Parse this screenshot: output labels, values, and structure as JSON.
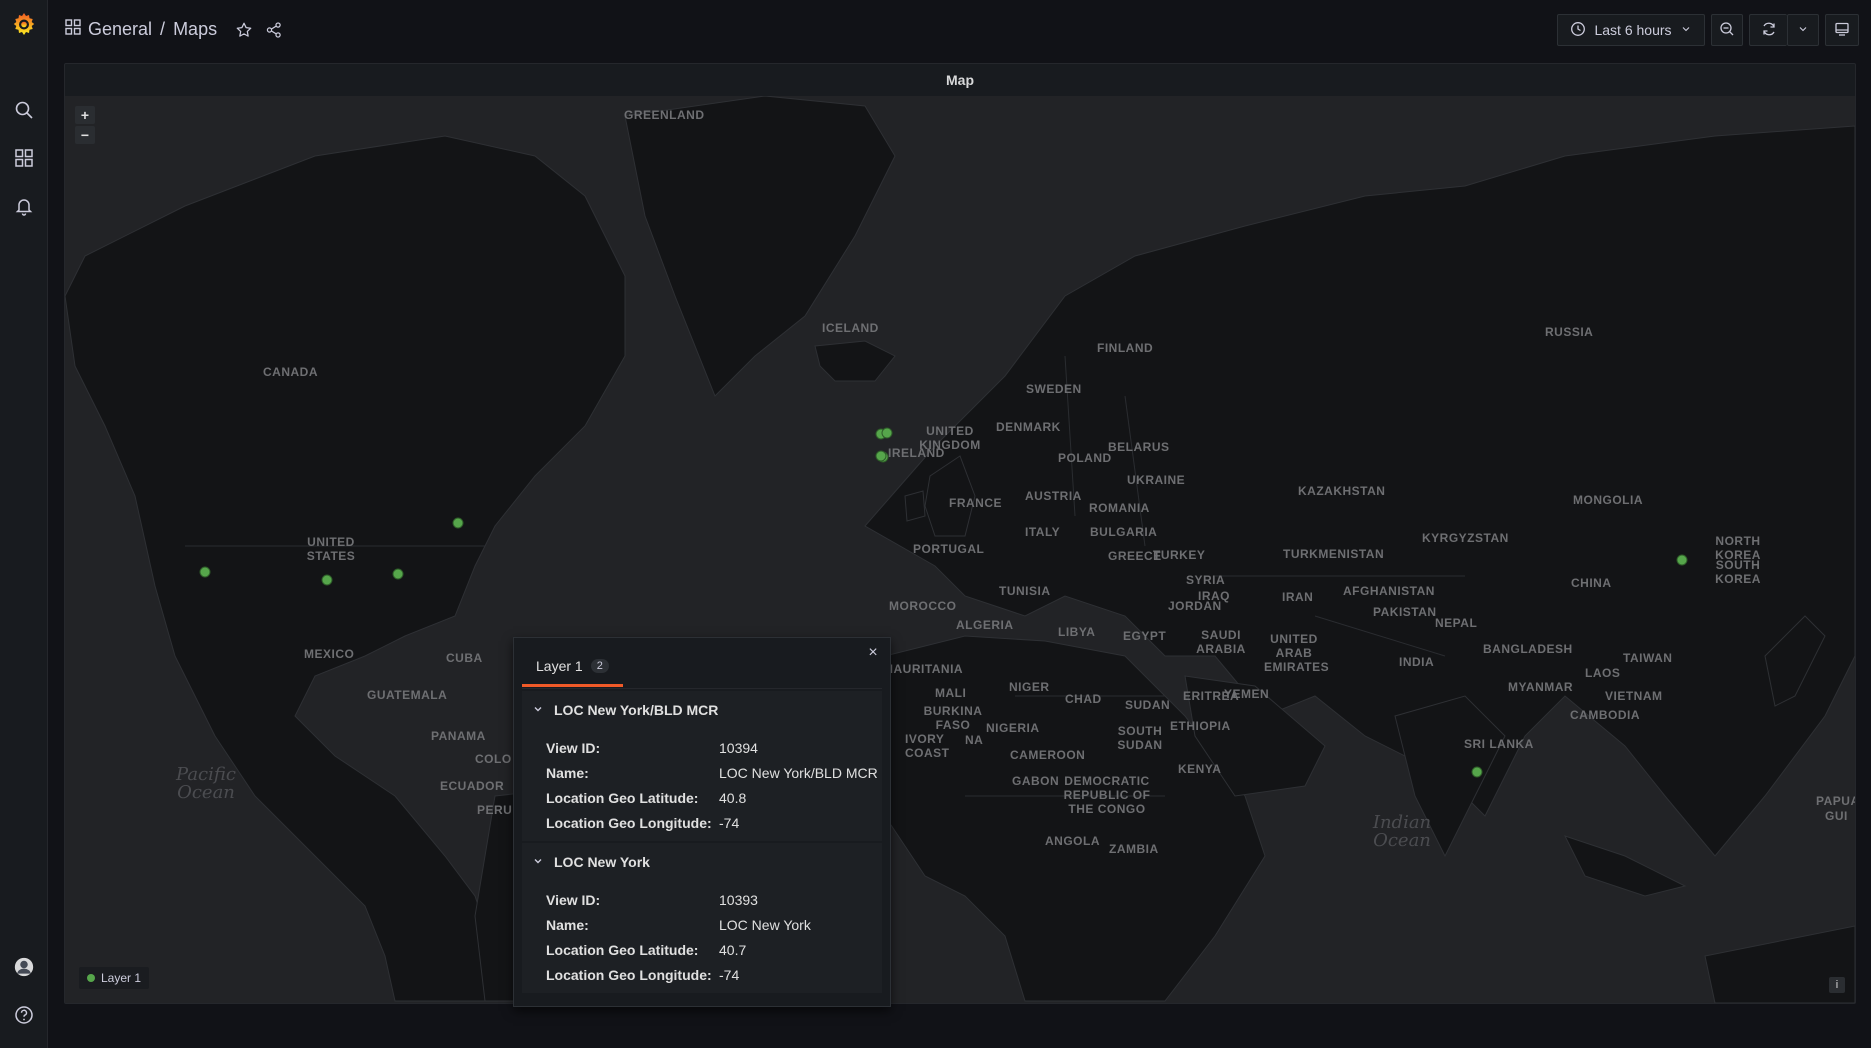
{
  "breadcrumb": {
    "folder": "General",
    "separator": "/",
    "dashboard": "Maps"
  },
  "toolbar": {
    "time_range": "Last 6 hours"
  },
  "panel": {
    "title": "Map"
  },
  "map": {
    "zoom_in": "+",
    "zoom_out": "−",
    "country_labels": [
      {
        "name": "GREENLAND"
      },
      {
        "name": "ICELAND"
      },
      {
        "name": "CANADA"
      },
      {
        "name": "FINLAND"
      },
      {
        "name": "SWEDEN"
      },
      {
        "name": "RUSSIA"
      },
      {
        "name": "UNITED KINGDOM"
      },
      {
        "name": "IRELAND"
      },
      {
        "name": "DENMARK"
      },
      {
        "name": "POLAND"
      },
      {
        "name": "BELARUS"
      },
      {
        "name": "UKRAINE"
      },
      {
        "name": "FRANCE"
      },
      {
        "name": "AUSTRIA"
      },
      {
        "name": "ROMANIA"
      },
      {
        "name": "ITALY"
      },
      {
        "name": "BULGARIA"
      },
      {
        "name": "KAZAKHSTAN"
      },
      {
        "name": "MONGOLIA"
      },
      {
        "name": "UNITED STATES"
      },
      {
        "name": "PORTUGAL"
      },
      {
        "name": "GREECE"
      },
      {
        "name": "TURKEY"
      },
      {
        "name": "KYRGYZSTAN"
      },
      {
        "name": "TURKMENISTAN"
      },
      {
        "name": "NORTH KOREA"
      },
      {
        "name": "SOUTH KOREA"
      },
      {
        "name": "TUNISIA"
      },
      {
        "name": "SYRIA"
      },
      {
        "name": "IRAQ"
      },
      {
        "name": "IRAN"
      },
      {
        "name": "AFGHANISTAN"
      },
      {
        "name": "CHINA"
      },
      {
        "name": "MOROCCO"
      },
      {
        "name": "JORDAN"
      },
      {
        "name": "PAKISTAN"
      },
      {
        "name": "ALGERIA"
      },
      {
        "name": "LIBYA"
      },
      {
        "name": "EGYPT"
      },
      {
        "name": "SAUDI ARABIA"
      },
      {
        "name": "NEPAL"
      },
      {
        "name": "BANGLADESH"
      },
      {
        "name": "UNITED ARAB EMIRATES"
      },
      {
        "name": "INDIA"
      },
      {
        "name": "TAIWAN"
      },
      {
        "name": "MEXICO"
      },
      {
        "name": "CUBA"
      },
      {
        "name": "MAURITANIA"
      },
      {
        "name": "MALI"
      },
      {
        "name": "NIGER"
      },
      {
        "name": "CHAD"
      },
      {
        "name": "ERITREA"
      },
      {
        "name": "YEMEN"
      },
      {
        "name": "LAOS"
      },
      {
        "name": "MYANMAR"
      },
      {
        "name": "VIETNAM"
      },
      {
        "name": "GUATEMALA"
      },
      {
        "name": "SUDAN"
      },
      {
        "name": "CAMBODIA"
      },
      {
        "name": "BURKINA FASO"
      },
      {
        "name": "PANAMA"
      },
      {
        "name": "IVORY COAST"
      },
      {
        "name": "NA"
      },
      {
        "name": "NIGERIA"
      },
      {
        "name": "ETHIOPIA"
      },
      {
        "name": "SOUTH SUDAN"
      },
      {
        "name": "SRI LANKA"
      },
      {
        "name": "COLO"
      },
      {
        "name": "CAMEROON"
      },
      {
        "name": "KENYA"
      },
      {
        "name": "GABON"
      },
      {
        "name": "DEMOCRATIC REPUBLIC OF THE CONGO"
      },
      {
        "name": "ECUADOR"
      },
      {
        "name": "PERU"
      },
      {
        "name": "ANGOLA"
      },
      {
        "name": "ZAMBIA"
      },
      {
        "name": "PAPUA"
      },
      {
        "name": "GUI"
      }
    ],
    "ocean_labels": [
      {
        "name": "Pacific Ocean"
      },
      {
        "name": "Indian Ocean"
      }
    ],
    "markers": [
      {
        "name": "marker-los-angeles",
        "lat": 34.0,
        "lon": -118.2
      },
      {
        "name": "marker-dallas",
        "lat": 32.8,
        "lon": -96.8
      },
      {
        "name": "marker-atlanta",
        "lat": 33.7,
        "lon": -84.4
      },
      {
        "name": "marker-new-york",
        "lat": 40.8,
        "lon": -74.0
      },
      {
        "name": "marker-london",
        "lat": 51.5,
        "lon": -0.1
      },
      {
        "name": "marker-amsterdam",
        "lat": 51.6,
        "lon": 0.8
      },
      {
        "name": "marker-paris-1",
        "lat": 48.9,
        "lon": 0.1
      },
      {
        "name": "marker-paris-2",
        "lat": 49.0,
        "lon": -0.2
      },
      {
        "name": "marker-tokyo",
        "lat": 35.7,
        "lon": 139.7
      },
      {
        "name": "marker-singapore",
        "lat": 1.3,
        "lon": 103.8
      }
    ],
    "legend_label": "Layer 1",
    "attribution": "i"
  },
  "popup": {
    "tab_label": "Layer 1",
    "tab_count": "2",
    "close": "×",
    "records": [
      {
        "title": "LOC New York/BLD MCR",
        "fields": [
          {
            "key": "View ID:",
            "value": "10394"
          },
          {
            "key": "Name:",
            "value": "LOC New York/BLD MCR"
          },
          {
            "key": "Location Geo Latitude:",
            "value": "40.8"
          },
          {
            "key": "Location Geo Longitude:",
            "value": "-74"
          }
        ]
      },
      {
        "title": "LOC New York",
        "fields": [
          {
            "key": "View ID:",
            "value": "10393"
          },
          {
            "key": "Name:",
            "value": "LOC New York"
          },
          {
            "key": "Location Geo Latitude:",
            "value": "40.7"
          },
          {
            "key": "Location Geo Longitude:",
            "value": "-74"
          }
        ]
      }
    ]
  },
  "colors": {
    "accent": "#f05a28",
    "marker": "#56a64b",
    "background": "#111217",
    "panel": "#181b1f"
  }
}
